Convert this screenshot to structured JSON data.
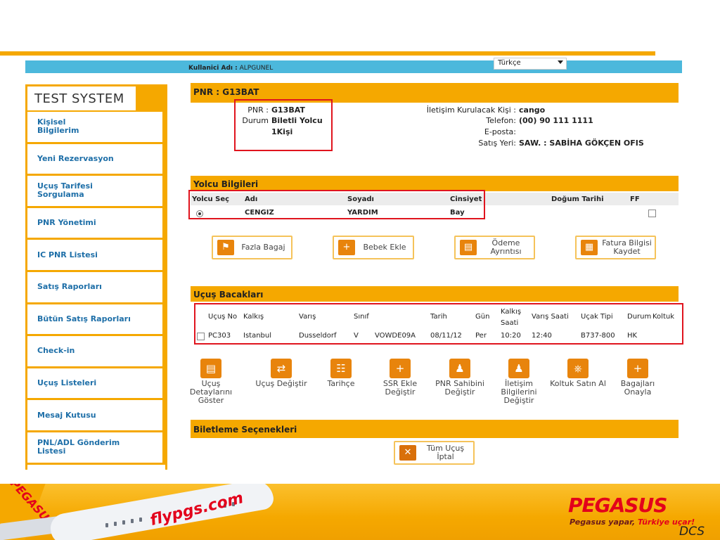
{
  "header": {
    "user_label": "Kullanici Adı :",
    "user_name": "ALPGUNEL",
    "language": "Türkçe"
  },
  "sidebar": {
    "title": "TEST SYSTEM",
    "items": [
      {
        "label": "Kişisel Bilgilerim"
      },
      {
        "label": "Yeni Rezervasyon"
      },
      {
        "label": "Uçuş Tarifesi Sorgulama"
      },
      {
        "label": "PNR Yönetimi"
      },
      {
        "label": "IC PNR Listesi"
      },
      {
        "label": "Satış Raporları"
      },
      {
        "label": "Bütün Satış Raporları"
      },
      {
        "label": "Check-in"
      },
      {
        "label": "Uçuş Listeleri"
      },
      {
        "label": "Mesaj Kutusu"
      },
      {
        "label": "PNL/ADL Gönderim Listesi"
      }
    ]
  },
  "pnr": {
    "header": "PNR : G13BAT",
    "pnr_label": "PNR :",
    "pnr_value": "G13BAT",
    "status_label": "Durum",
    "status_value": "Biletli Yolcu",
    "count": "1Kişi",
    "contact_label": "İletişim Kurulacak Kişi :",
    "contact_value": "cango",
    "phone_label": "Telefon:",
    "phone_value": "(00) 90 111 1111",
    "email_label": "E-posta:",
    "email_value": "",
    "office_label": "Satış Yeri:",
    "office_value": "SAW. : SABİHA GÖKÇEN OFIS"
  },
  "passengers": {
    "title": "Yolcu Bilgileri",
    "columns": [
      "Yolcu Seç",
      "Adı",
      "Soyadı",
      "Cinsiyet",
      "Doğum Tarihi",
      "FF"
    ],
    "rows": [
      {
        "name": "CENGIZ",
        "surname": "YARDIM",
        "gender": "Bay",
        "birth": ""
      }
    ]
  },
  "passenger_actions": [
    {
      "label": "Fazla Bagaj",
      "icon": "baggage-tag-icon"
    },
    {
      "label": "Bebek Ekle",
      "icon": "add-infant-icon"
    },
    {
      "label": "Ödeme Ayrıntısı",
      "icon": "payment-icon"
    },
    {
      "label": "Fatura Bilgisi Kaydet",
      "icon": "invoice-icon"
    }
  ],
  "legs": {
    "title": "Uçuş Bacakları",
    "columns": {
      "flight_no": "Uçuş No",
      "departure": "Kalkış",
      "arrival": "Varış",
      "class": "Sınıf",
      "date": "Tarih",
      "day": "Gün",
      "dep_time": "Kalkış Saati",
      "arr_time": "Varış Saati",
      "aircraft": "Uçak Tipi",
      "status": "Durum",
      "seat": "Koltuk"
    },
    "rows": [
      {
        "flight_no": "PC303",
        "departure": "Istanbul",
        "arrival": "Dusseldorf",
        "class": "V",
        "fare": "VOWDE09A",
        "date": "08/11/12",
        "day": "Per",
        "dep_time": "10:20",
        "arr_time": "12:40",
        "aircraft": "B737-800",
        "status": "HK",
        "seat": ""
      }
    ]
  },
  "leg_tools": [
    {
      "label": "Uçuş Detaylarını Göster",
      "icon": "flight-details-icon"
    },
    {
      "label": "Uçuş Değiştir",
      "icon": "change-flight-icon"
    },
    {
      "label": "Tarihçe",
      "icon": "history-icon"
    },
    {
      "label": "SSR Ekle Değiştir",
      "icon": "ssr-icon"
    },
    {
      "label": "PNR Sahibini Değiştir",
      "icon": "change-owner-icon"
    },
    {
      "label": "İletişim Bilgilerini Değiştir",
      "icon": "contact-info-icon"
    },
    {
      "label": "Koltuk Satın Al",
      "icon": "seat-icon"
    },
    {
      "label": "Bagajları Onayla",
      "icon": "confirm-baggage-icon"
    }
  ],
  "ticketing": {
    "title": "Biletleme Seçenekleri",
    "cancel_all": "Tüm Uçuş İptal"
  },
  "footer": {
    "tail_text": "PEGASUS",
    "fuselage_text": "flypgs.com",
    "brand": "PEGASUS",
    "slogan_prefix": "Pegasus yapar,",
    "slogan_suffix": "Türkiye uçar!",
    "corner": "DCS"
  },
  "colors": {
    "accent": "#f5a800",
    "top_bar": "#4cb8dc",
    "link": "#1e6fa8",
    "highlight_box": "#e0141e",
    "brand_red": "#e3001b"
  }
}
